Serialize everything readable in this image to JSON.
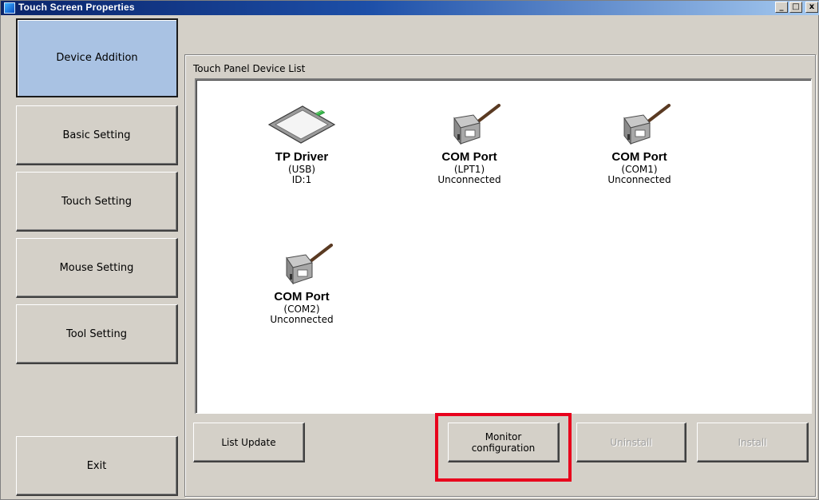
{
  "window": {
    "title": "Touch Screen Properties",
    "controls": {
      "minimize": "_",
      "maximize": "□",
      "close": "x"
    }
  },
  "sidebar": {
    "items": [
      {
        "label": "Device Addition",
        "active": true
      },
      {
        "label": "Basic Setting",
        "active": false
      },
      {
        "label": "Touch Setting",
        "active": false
      },
      {
        "label": "Mouse Setting",
        "active": false
      },
      {
        "label": "Tool Setting",
        "active": false
      }
    ],
    "exit_label": "Exit"
  },
  "main": {
    "group_label": "Touch Panel Device List",
    "devices": [
      {
        "icon": "touch-panel-icon",
        "name": "TP Driver",
        "sub": "(USB)",
        "status": "ID:1"
      },
      {
        "icon": "com-port-connector-icon",
        "name": "COM Port",
        "sub": "(LPT1)",
        "status": "Unconnected"
      },
      {
        "icon": "com-port-connector-icon",
        "name": "COM Port",
        "sub": "(COM1)",
        "status": "Unconnected"
      },
      {
        "icon": "com-port-connector-icon",
        "name": "COM Port",
        "sub": "(COM2)",
        "status": "Unconnected"
      }
    ],
    "buttons": {
      "list_update": "List Update",
      "monitor_configuration_line1": "Monitor",
      "monitor_configuration_line2": "configuration",
      "uninstall": "Uninstall",
      "install": "Install"
    }
  },
  "colors": {
    "highlight": "#e8001c",
    "active_nav": "#a9c2e3",
    "titlebar": "#0a246a"
  }
}
